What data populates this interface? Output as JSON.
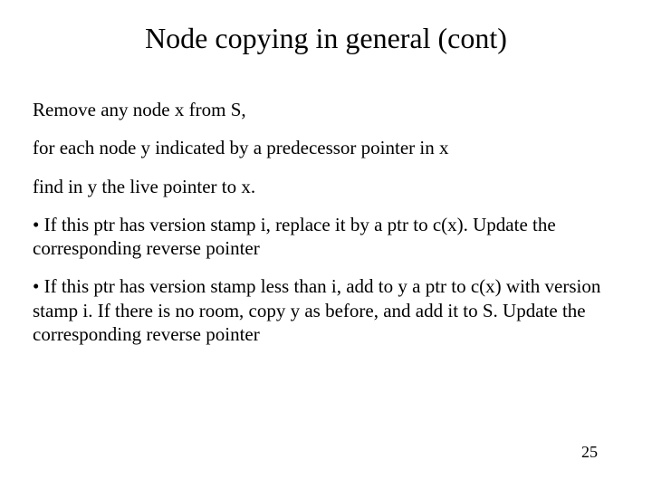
{
  "title": "Node copying in general (cont)",
  "paragraphs": {
    "p0": "Remove any node x from S,",
    "p1": "for each node y indicated by a predecessor pointer in x",
    "p2": "find in y the live pointer to x.",
    "p3": "• If this ptr has version stamp i, replace it by a ptr to c(x). Update the corresponding reverse pointer",
    "p4": "• If this ptr has version stamp less than i, add to y a ptr to c(x) with version stamp i. If there is no room, copy y as before, and add it to S. Update the corresponding reverse pointer"
  },
  "page_number": "25"
}
